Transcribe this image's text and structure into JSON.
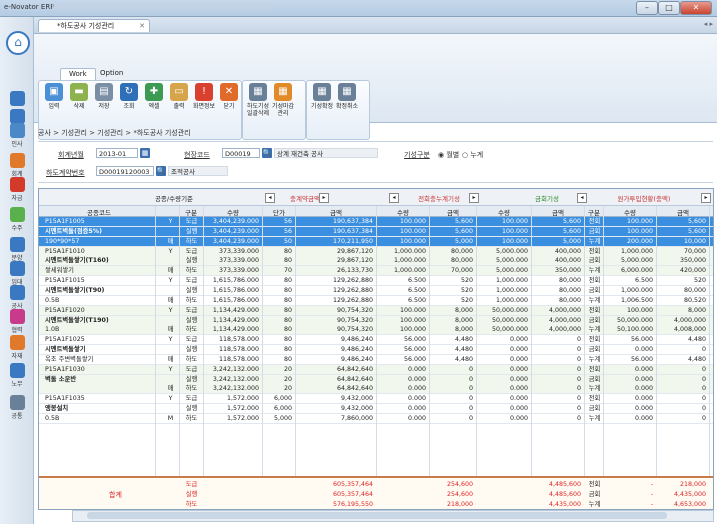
{
  "window": {
    "title": "e-Novator ERP"
  },
  "nav": [
    {
      "label": "",
      "icon": "house-icon"
    },
    {
      "label": "",
      "icon": "tile-icon"
    },
    {
      "label": "",
      "icon": "star-icon"
    },
    {
      "label": "인사",
      "icon": "people-icon"
    },
    {
      "label": "회계",
      "icon": "briefcase-icon"
    },
    {
      "label": "자금",
      "icon": "won-icon"
    },
    {
      "label": "수주",
      "icon": "flag-icon"
    },
    {
      "label": "분양",
      "icon": "building-icon"
    },
    {
      "label": "임대",
      "icon": "book-icon"
    },
    {
      "label": "공사",
      "icon": "crane-icon"
    },
    {
      "label": "협력",
      "icon": "handshake-icon"
    },
    {
      "label": "자재",
      "icon": "truck-icon"
    },
    {
      "label": "노무",
      "icon": "worker-icon"
    },
    {
      "label": "공통",
      "icon": "gear-icon"
    }
  ],
  "tab": {
    "label": "*하도공사 기성관리"
  },
  "ribbon": {
    "tabs": [
      "Work",
      "Option"
    ],
    "buttons": [
      {
        "label": "입력",
        "icon": "input-icon",
        "color": "#4b8fd6"
      },
      {
        "label": "삭제",
        "icon": "delete-icon",
        "color": "#8cb34d"
      },
      {
        "label": "저장",
        "icon": "save-icon",
        "color": "#7a8ea4"
      },
      {
        "label": "조회",
        "icon": "refresh-icon",
        "color": "#2f6fb8"
      },
      {
        "label": "엑셀",
        "icon": "excel-icon",
        "color": "#3d9a52"
      },
      {
        "label": "출력",
        "icon": "print-icon",
        "color": "#d6a44b"
      },
      {
        "label": "화면정보",
        "icon": "info-icon",
        "color": "#d9412e"
      },
      {
        "label": "닫기",
        "icon": "close-icon",
        "color": "#e06a2a"
      },
      {
        "label": "하도기성\n일괄삭제",
        "icon": "batch-delete-icon",
        "color": "#6a7f98"
      },
      {
        "label": "기성마감\n관리",
        "icon": "close-manage-icon",
        "color": "#e08a2a"
      },
      {
        "label": "기성확정",
        "icon": "confirm-icon",
        "color": "#6a7f98"
      },
      {
        "label": "확정취소",
        "icon": "cancel-confirm-icon",
        "color": "#6a7f98"
      }
    ]
  },
  "breadcrumb": "공사 > 기성관리 > 기성관리 > *하도공사 기성관리",
  "filters": {
    "period_label": "회계년월",
    "period_value": "2013-01",
    "site_label": "현장코드",
    "site_code": "D00019",
    "site_name": "상계 재건축 공사",
    "type_label": "기성구분",
    "type_opt1": "월별",
    "type_opt2": "누계",
    "contract_label": "하도계약번호",
    "contract_code": "D00019120003",
    "contract_name": "조적공사"
  },
  "grid": {
    "group_headers": {
      "base": "공종/수량기준",
      "current": "충계약금액",
      "prev": "전회충누계기성",
      "this": "금회기성",
      "cum": "원가투입현황(충액)"
    },
    "columns": [
      "공종코드",
      "",
      "구분",
      "수량",
      "단가",
      "금액",
      "수량",
      "금액",
      "수량",
      "금액",
      "구분",
      "수량",
      "금액"
    ],
    "rows": [
      {
        "code": "P15A1F1005",
        "flag": "Y",
        "div": "도급",
        "qty": "3,404,239.000",
        "price": "56",
        "amt": "190,637,384",
        "pq": "100.000",
        "pa": "5,600",
        "cq": "100.000",
        "ca": "5,600",
        "k": "전회",
        "kq": "100.000",
        "ka": "5,600",
        "sel": true
      },
      {
        "code": "시멘트벽돌(점증5%)",
        "flag": "",
        "div": "실행",
        "qty": "3,404,239.000",
        "price": "56",
        "amt": "190,637,384",
        "pq": "100.000",
        "pa": "5,600",
        "cq": "100.000",
        "ca": "5,600",
        "k": "금회",
        "kq": "100.000",
        "ka": "5,600",
        "sel": true,
        "bold": true
      },
      {
        "code": "190*90*57",
        "flag": "매",
        "div": "하도",
        "qty": "3,404,239.000",
        "price": "50",
        "amt": "170,211,950",
        "pq": "100.000",
        "pa": "5,000",
        "cq": "100.000",
        "ca": "5,000",
        "k": "누계",
        "kq": "200.000",
        "ka": "10,000",
        "sel": true
      },
      {
        "code": "P15A1F1010",
        "flag": "Y",
        "div": "도급",
        "qty": "373,339.000",
        "price": "80",
        "amt": "29,867,120",
        "pq": "1,000.000",
        "pa": "80,000",
        "cq": "5,000.000",
        "ca": "400,000",
        "k": "전회",
        "kq": "1,000.000",
        "ka": "70,000"
      },
      {
        "code": "시멘트벽돌쌓기(T160)",
        "flag": "",
        "div": "실행",
        "qty": "373,339.000",
        "price": "80",
        "amt": "29,867,120",
        "pq": "1,000.000",
        "pa": "80,000",
        "cq": "5,000.000",
        "ca": "400,000",
        "k": "금회",
        "kq": "5,000.000",
        "ka": "350,000",
        "bold": true
      },
      {
        "code": "쌓세워쌓기",
        "flag": "매",
        "div": "하도",
        "qty": "373,339.000",
        "price": "70",
        "amt": "26,133,730",
        "pq": "1,000.000",
        "pa": "70,000",
        "cq": "5,000.000",
        "ca": "350,000",
        "k": "누계",
        "kq": "6,000.000",
        "ka": "420,000"
      },
      {
        "code": "P15A1F1015",
        "flag": "Y",
        "div": "도급",
        "qty": "1,615,786.000",
        "price": "80",
        "amt": "129,262,880",
        "pq": "6.500",
        "pa": "520",
        "cq": "1,000.000",
        "ca": "80,000",
        "k": "전회",
        "kq": "6.500",
        "ka": "520"
      },
      {
        "code": "시멘트벽돌쌓기(T90)",
        "flag": "",
        "div": "실행",
        "qty": "1,615,786.000",
        "price": "80",
        "amt": "129,262,880",
        "pq": "6.500",
        "pa": "520",
        "cq": "1,000.000",
        "ca": "80,000",
        "k": "금회",
        "kq": "1,000.000",
        "ka": "80,000",
        "bold": true
      },
      {
        "code": "0.5B",
        "flag": "매",
        "div": "하도",
        "qty": "1,615,786.000",
        "price": "80",
        "amt": "129,262,880",
        "pq": "6.500",
        "pa": "520",
        "cq": "1,000.000",
        "ca": "80,000",
        "k": "누계",
        "kq": "1,006.500",
        "ka": "80,520"
      },
      {
        "code": "P15A1F1020",
        "flag": "Y",
        "div": "도급",
        "qty": "1,134,429.000",
        "price": "80",
        "amt": "90,754,320",
        "pq": "100.000",
        "pa": "8,000",
        "cq": "50,000.000",
        "ca": "4,000,000",
        "k": "전회",
        "kq": "100.000",
        "ka": "8,000"
      },
      {
        "code": "시멘트벽돌쌓기(T190)",
        "flag": "",
        "div": "실행",
        "qty": "1,134,429.000",
        "price": "80",
        "amt": "90,754,320",
        "pq": "100.000",
        "pa": "8,000",
        "cq": "50,000.000",
        "ca": "4,000,000",
        "k": "금회",
        "kq": "50,000.000",
        "ka": "4,000,000",
        "bold": true
      },
      {
        "code": "1.0B",
        "flag": "매",
        "div": "하도",
        "qty": "1,134,429.000",
        "price": "80",
        "amt": "90,754,320",
        "pq": "100.000",
        "pa": "8,000",
        "cq": "50,000.000",
        "ca": "4,000,000",
        "k": "누계",
        "kq": "50,100.000",
        "ka": "4,008,000"
      },
      {
        "code": "P15A1F1025",
        "flag": "Y",
        "div": "도급",
        "qty": "118,578.000",
        "price": "80",
        "amt": "9,486,240",
        "pq": "56.000",
        "pa": "4,480",
        "cq": "0.000",
        "ca": "0",
        "k": "전회",
        "kq": "56.000",
        "ka": "4,480"
      },
      {
        "code": "시멘트벽돌쌓기",
        "flag": "",
        "div": "실행",
        "qty": "118,578.000",
        "price": "80",
        "amt": "9,486,240",
        "pq": "56.000",
        "pa": "4,480",
        "cq": "0.000",
        "ca": "0",
        "k": "금회",
        "kq": "0.000",
        "ka": "0",
        "bold": true
      },
      {
        "code": "옥조 주변벽돌쌓기",
        "flag": "매",
        "div": "하도",
        "qty": "118,578.000",
        "price": "80",
        "amt": "9,486,240",
        "pq": "56.000",
        "pa": "4,480",
        "cq": "0.000",
        "ca": "0",
        "k": "누계",
        "kq": "56.000",
        "ka": "4,480"
      },
      {
        "code": "P15A1F1030",
        "flag": "Y",
        "div": "도급",
        "qty": "3,242,132.000",
        "price": "20",
        "amt": "64,842,640",
        "pq": "0.000",
        "pa": "0",
        "cq": "0.000",
        "ca": "0",
        "k": "전회",
        "kq": "0.000",
        "ka": "0"
      },
      {
        "code": "벽돌 소운반",
        "flag": "",
        "div": "실행",
        "qty": "3,242,132.000",
        "price": "20",
        "amt": "64,842,640",
        "pq": "0.000",
        "pa": "0",
        "cq": "0.000",
        "ca": "0",
        "k": "금회",
        "kq": "0.000",
        "ka": "0",
        "bold": true
      },
      {
        "code": "",
        "flag": "매",
        "div": "하도",
        "qty": "3,242,132.000",
        "price": "20",
        "amt": "64,842,640",
        "pq": "0.000",
        "pa": "0",
        "cq": "0.000",
        "ca": "0",
        "k": "누계",
        "kq": "0.000",
        "ka": "0"
      },
      {
        "code": "P15A1F1035",
        "flag": "Y",
        "div": "도급",
        "qty": "1,572.000",
        "price": "6,000",
        "amt": "9,432,000",
        "pq": "0.000",
        "pa": "0",
        "cq": "0.000",
        "ca": "0",
        "k": "전회",
        "kq": "0.000",
        "ka": "0"
      },
      {
        "code": "앵봉설치",
        "flag": "",
        "div": "실행",
        "qty": "1,572.000",
        "price": "6,000",
        "amt": "9,432,000",
        "pq": "0.000",
        "pa": "0",
        "cq": "0.000",
        "ca": "0",
        "k": "금회",
        "kq": "0.000",
        "ka": "0",
        "bold": true
      },
      {
        "code": "0.5B",
        "flag": "M",
        "div": "하도",
        "qty": "1,572.000",
        "price": "5,000",
        "amt": "7,860,000",
        "pq": "0.000",
        "pa": "0",
        "cq": "0.000",
        "ca": "0",
        "k": "누계",
        "kq": "0.000",
        "ka": "0"
      }
    ],
    "footer": {
      "label": "합계",
      "rows": [
        {
          "div": "도급",
          "amt": "605,357,464",
          "pa": "254,600",
          "ca": "4,485,600",
          "k": "전회",
          "kq": "-",
          "ka": "218,000"
        },
        {
          "div": "실행",
          "amt": "605,357,464",
          "pa": "254,600",
          "ca": "4,485,600",
          "k": "금회",
          "kq": "-",
          "ka": "4,435,000"
        },
        {
          "div": "하도",
          "amt": "576,195,550",
          "pa": "218,000",
          "ca": "4,435,000",
          "k": "누계",
          "kq": "-",
          "ka": "4,653,000"
        }
      ]
    }
  }
}
